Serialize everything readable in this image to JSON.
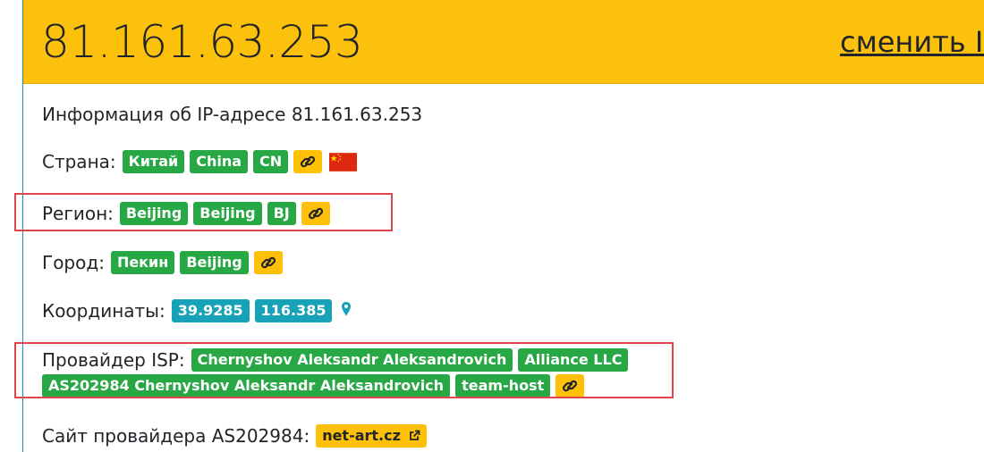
{
  "header": {
    "ip": "81.161.63.253",
    "change_link": "сменить IP"
  },
  "info_title": "Информация об IP-адресе 81.161.63.253",
  "country": {
    "label": "Страна:",
    "badges": [
      "Китай",
      "China",
      "CN"
    ],
    "flag": "china-flag-icon"
  },
  "region": {
    "label": "Регион:",
    "badges": [
      "Beijing",
      "Beijing",
      "BJ"
    ]
  },
  "city": {
    "label": "Город:",
    "badges": [
      "Пекин",
      "Beijing"
    ]
  },
  "coordinates": {
    "label": "Координаты:",
    "lat": "39.9285",
    "lon": "116.385"
  },
  "isp": {
    "label": "Провайдер ISP:",
    "badges": [
      "Chernyshov Aleksandr Aleksandrovich",
      "Alliance LLC",
      "AS202984 Chernyshov Aleksandr Aleksandrovich",
      "team-host"
    ]
  },
  "isp_site": {
    "label": "Сайт провайдера AS202984:",
    "link": "net-art.cz"
  },
  "colors": {
    "header": "#fcc10c",
    "badge_green": "#28a745",
    "badge_cyan": "#17a2b8",
    "badge_yellow": "#ffc107",
    "highlight": "#e0454b"
  }
}
